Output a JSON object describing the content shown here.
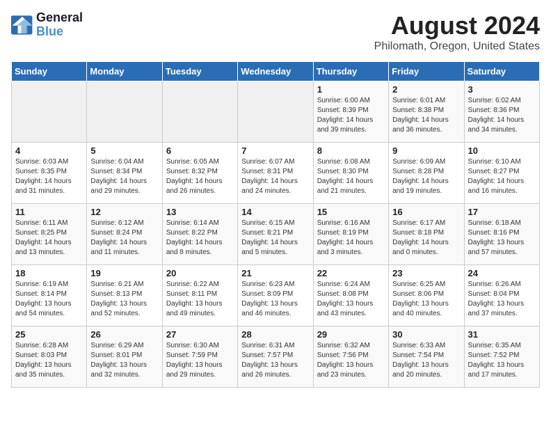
{
  "logo": {
    "line1": "General",
    "line2": "Blue"
  },
  "title": "August 2024",
  "subtitle": "Philomath, Oregon, United States",
  "days_of_week": [
    "Sunday",
    "Monday",
    "Tuesday",
    "Wednesday",
    "Thursday",
    "Friday",
    "Saturday"
  ],
  "weeks": [
    [
      {
        "num": "",
        "info": ""
      },
      {
        "num": "",
        "info": ""
      },
      {
        "num": "",
        "info": ""
      },
      {
        "num": "",
        "info": ""
      },
      {
        "num": "1",
        "info": "Sunrise: 6:00 AM\nSunset: 8:39 PM\nDaylight: 14 hours\nand 39 minutes."
      },
      {
        "num": "2",
        "info": "Sunrise: 6:01 AM\nSunset: 8:38 PM\nDaylight: 14 hours\nand 36 minutes."
      },
      {
        "num": "3",
        "info": "Sunrise: 6:02 AM\nSunset: 8:36 PM\nDaylight: 14 hours\nand 34 minutes."
      }
    ],
    [
      {
        "num": "4",
        "info": "Sunrise: 6:03 AM\nSunset: 8:35 PM\nDaylight: 14 hours\nand 31 minutes."
      },
      {
        "num": "5",
        "info": "Sunrise: 6:04 AM\nSunset: 8:34 PM\nDaylight: 14 hours\nand 29 minutes."
      },
      {
        "num": "6",
        "info": "Sunrise: 6:05 AM\nSunset: 8:32 PM\nDaylight: 14 hours\nand 26 minutes."
      },
      {
        "num": "7",
        "info": "Sunrise: 6:07 AM\nSunset: 8:31 PM\nDaylight: 14 hours\nand 24 minutes."
      },
      {
        "num": "8",
        "info": "Sunrise: 6:08 AM\nSunset: 8:30 PM\nDaylight: 14 hours\nand 21 minutes."
      },
      {
        "num": "9",
        "info": "Sunrise: 6:09 AM\nSunset: 8:28 PM\nDaylight: 14 hours\nand 19 minutes."
      },
      {
        "num": "10",
        "info": "Sunrise: 6:10 AM\nSunset: 8:27 PM\nDaylight: 14 hours\nand 16 minutes."
      }
    ],
    [
      {
        "num": "11",
        "info": "Sunrise: 6:11 AM\nSunset: 8:25 PM\nDaylight: 14 hours\nand 13 minutes."
      },
      {
        "num": "12",
        "info": "Sunrise: 6:12 AM\nSunset: 8:24 PM\nDaylight: 14 hours\nand 11 minutes."
      },
      {
        "num": "13",
        "info": "Sunrise: 6:14 AM\nSunset: 8:22 PM\nDaylight: 14 hours\nand 8 minutes."
      },
      {
        "num": "14",
        "info": "Sunrise: 6:15 AM\nSunset: 8:21 PM\nDaylight: 14 hours\nand 5 minutes."
      },
      {
        "num": "15",
        "info": "Sunrise: 6:16 AM\nSunset: 8:19 PM\nDaylight: 14 hours\nand 3 minutes."
      },
      {
        "num": "16",
        "info": "Sunrise: 6:17 AM\nSunset: 8:18 PM\nDaylight: 14 hours\nand 0 minutes."
      },
      {
        "num": "17",
        "info": "Sunrise: 6:18 AM\nSunset: 8:16 PM\nDaylight: 13 hours\nand 57 minutes."
      }
    ],
    [
      {
        "num": "18",
        "info": "Sunrise: 6:19 AM\nSunset: 8:14 PM\nDaylight: 13 hours\nand 54 minutes."
      },
      {
        "num": "19",
        "info": "Sunrise: 6:21 AM\nSunset: 8:13 PM\nDaylight: 13 hours\nand 52 minutes."
      },
      {
        "num": "20",
        "info": "Sunrise: 6:22 AM\nSunset: 8:11 PM\nDaylight: 13 hours\nand 49 minutes."
      },
      {
        "num": "21",
        "info": "Sunrise: 6:23 AM\nSunset: 8:09 PM\nDaylight: 13 hours\nand 46 minutes."
      },
      {
        "num": "22",
        "info": "Sunrise: 6:24 AM\nSunset: 8:08 PM\nDaylight: 13 hours\nand 43 minutes."
      },
      {
        "num": "23",
        "info": "Sunrise: 6:25 AM\nSunset: 8:06 PM\nDaylight: 13 hours\nand 40 minutes."
      },
      {
        "num": "24",
        "info": "Sunrise: 6:26 AM\nSunset: 8:04 PM\nDaylight: 13 hours\nand 37 minutes."
      }
    ],
    [
      {
        "num": "25",
        "info": "Sunrise: 6:28 AM\nSunset: 8:03 PM\nDaylight: 13 hours\nand 35 minutes."
      },
      {
        "num": "26",
        "info": "Sunrise: 6:29 AM\nSunset: 8:01 PM\nDaylight: 13 hours\nand 32 minutes."
      },
      {
        "num": "27",
        "info": "Sunrise: 6:30 AM\nSunset: 7:59 PM\nDaylight: 13 hours\nand 29 minutes."
      },
      {
        "num": "28",
        "info": "Sunrise: 6:31 AM\nSunset: 7:57 PM\nDaylight: 13 hours\nand 26 minutes."
      },
      {
        "num": "29",
        "info": "Sunrise: 6:32 AM\nSunset: 7:56 PM\nDaylight: 13 hours\nand 23 minutes."
      },
      {
        "num": "30",
        "info": "Sunrise: 6:33 AM\nSunset: 7:54 PM\nDaylight: 13 hours\nand 20 minutes."
      },
      {
        "num": "31",
        "info": "Sunrise: 6:35 AM\nSunset: 7:52 PM\nDaylight: 13 hours\nand 17 minutes."
      }
    ]
  ]
}
